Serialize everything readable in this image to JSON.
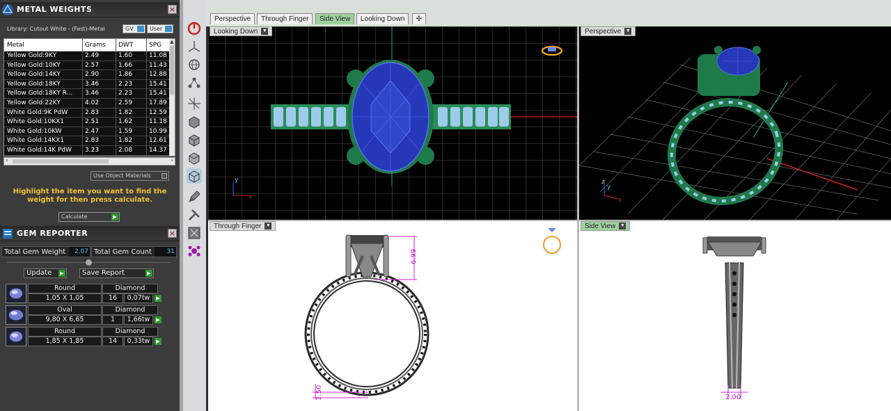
{
  "metal_weights": {
    "title": "METAL WEIGHTS",
    "library": "Library: Cutout White - (Fast)-Metal",
    "gv_label": "GV",
    "user_label": "User",
    "columns": [
      "Metal",
      "Grams",
      "DWT",
      "SPG"
    ],
    "rows": [
      [
        "Yellow Gold:9KY",
        "2.49",
        "1.60",
        "11.08"
      ],
      [
        "Yellow Gold:10KY",
        "2.57",
        "1.66",
        "11.43"
      ],
      [
        "Yellow Gold:14KY",
        "2.90",
        "1.86",
        "12.88"
      ],
      [
        "Yellow Gold:18KY",
        "3.46",
        "2.23",
        "15.41"
      ],
      [
        "Yellow Gold:18KY R...",
        "3.46",
        "2.23",
        "15.41"
      ],
      [
        "Yellow Gold:22KY",
        "4.02",
        "2.59",
        "17.89"
      ],
      [
        "White Gold:9K PdW",
        "2.83",
        "1.82",
        "12.59"
      ],
      [
        "White Gold:10KX1",
        "2.51",
        "1.62",
        "11.18"
      ],
      [
        "White Gold:10KW",
        "2.47",
        "1.59",
        "10.99"
      ],
      [
        "White Gold:14KX1",
        "2.83",
        "1.82",
        "12.61"
      ],
      [
        "White Gold:14K PdW",
        "3.23",
        "2.08",
        "14.37"
      ]
    ],
    "use_object_materials": "Use Object Materials",
    "highlight_msg": "Highlight the item you want to find the weight for then press calculate.",
    "calculate": "Calculate"
  },
  "gem_reporter": {
    "title": "GEM REPORTER",
    "total_weight_label": "Total Gem Weight",
    "total_weight": "2,07",
    "total_count_label": "Total Gem Count",
    "total_count": "31",
    "update": "Update",
    "save_report": "Save Report",
    "gems": [
      {
        "shape": "Round",
        "size": "1,05 X 1,05",
        "material": "Diamond",
        "count": "16",
        "ctw": "0,07tw"
      },
      {
        "shape": "Oval",
        "size": "9,80 X 6,65",
        "material": "Diamond",
        "count": "1",
        "ctw": "1,66tw"
      },
      {
        "shape": "Round",
        "size": "1,85 X 1,85",
        "material": "Diamond",
        "count": "14",
        "ctw": "0,33tw"
      }
    ]
  },
  "view_tabs": [
    "Perspective",
    "Through Finger",
    "Side View",
    "Looking Down"
  ],
  "active_tab": "Side View",
  "viewports": {
    "top_left": "Looking Down",
    "top_right": "Perspective",
    "bottom_left": "Through Finger",
    "bottom_right": "Side View"
  },
  "dimensions": {
    "prong_height": "6.99",
    "shank_thickness": "1.50",
    "shank_width": "2.00"
  },
  "colors": {
    "metal_green": "#1f7a4a",
    "gem_blue": "#2438b8",
    "accent_yellow": "#f2c234",
    "dimension_magenta": "#d020d0"
  }
}
